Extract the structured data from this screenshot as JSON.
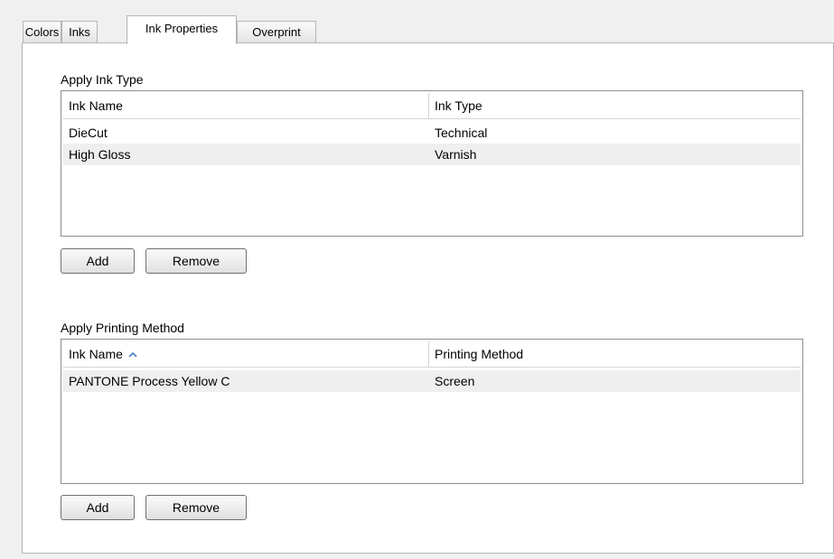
{
  "tabs": [
    {
      "label": "Colors"
    },
    {
      "label": "Inks"
    },
    {
      "label": "Ink Properties",
      "active": true
    },
    {
      "label": "Overprint"
    }
  ],
  "ink_type": {
    "group_label": "Apply Ink Type",
    "columns": [
      "Ink Name",
      "Ink Type"
    ],
    "rows": [
      {
        "name": "DieCut",
        "value": "Technical"
      },
      {
        "name": "High Gloss",
        "value": "Varnish"
      }
    ],
    "add_label": "Add",
    "remove_label": "Remove"
  },
  "printing_method": {
    "group_label": "Apply Printing Method",
    "columns": [
      "Ink Name",
      "Printing Method"
    ],
    "sort_icon": "sort-ascending-icon",
    "rows": [
      {
        "name": "PANTONE Process Yellow C",
        "value": "Screen"
      }
    ],
    "add_label": "Add",
    "remove_label": "Remove"
  }
}
